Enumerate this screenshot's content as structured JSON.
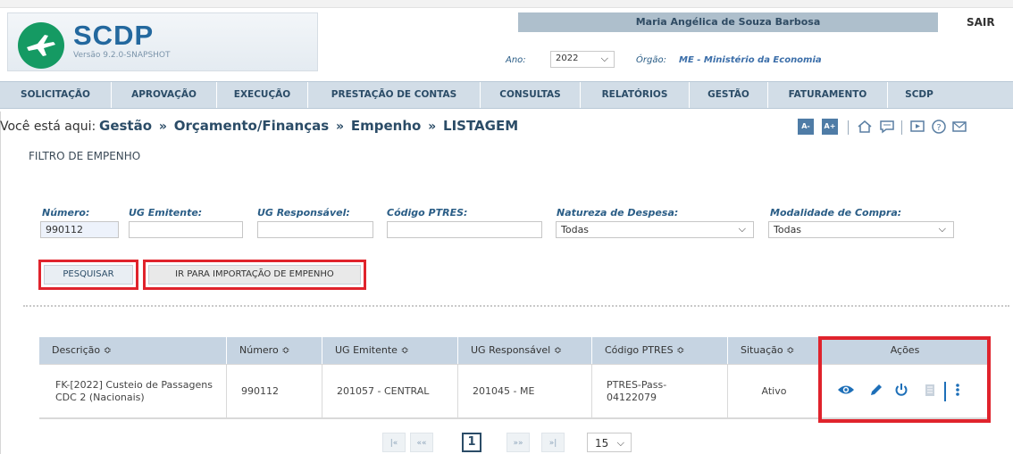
{
  "header": {
    "app_name": "SCDP",
    "version": "Versão 9.2.0-SNAPSHOT",
    "user_name": "Maria Angélica de Souza Barbosa",
    "logout_label": "SAIR",
    "ano_label": "Ano:",
    "ano_value": "2022",
    "orgao_label": "Órgão:",
    "orgao_value": "ME - Ministério da Economia"
  },
  "menu": {
    "items": [
      "SOLICITAÇÃO",
      "APROVAÇÃO",
      "EXECUÇÃO",
      "PRESTAÇÃO DE CONTAS",
      "CONSULTAS",
      "RELATÓRIOS",
      "GESTÃO",
      "FATURAMENTO",
      "SCDP"
    ]
  },
  "breadcrumb": {
    "prefix": "Você está aqui:",
    "parts": [
      "Gestão",
      "Orçamento/Finanças",
      "Empenho",
      "LISTAGEM"
    ],
    "separator": "»"
  },
  "toolbar": {
    "font_decrease": "A-",
    "font_increase": "A+",
    "icons": [
      "font-decrease-icon",
      "font-increase-icon",
      "home-icon",
      "chat-icon",
      "video-icon",
      "help-icon",
      "mail-icon"
    ]
  },
  "filter": {
    "title": "FILTRO DE EMPENHO",
    "fields": {
      "numero": {
        "label": "Número:",
        "value": "990112"
      },
      "ug_emitente": {
        "label": "UG Emitente:",
        "value": ""
      },
      "ug_responsavel": {
        "label": "UG Responsável:",
        "value": ""
      },
      "codigo_ptres": {
        "label": "Código PTRES:",
        "value": ""
      },
      "natureza_despesa": {
        "label": "Natureza de Despesa:",
        "value": "Todas"
      },
      "modalidade_compra": {
        "label": "Modalidade de Compra:",
        "value": "Todas"
      }
    },
    "search_button": "PESQUISAR",
    "import_button": "IR PARA IMPORTAÇÃO DE EMPENHO"
  },
  "table": {
    "columns": [
      "Descrição",
      "Número",
      "UG Emitente",
      "UG Responsável",
      "Código PTRES",
      "Situação",
      "Ações"
    ],
    "sort_glyph": "≎",
    "rows": [
      {
        "descricao": "FK-[2022] Custeio de Passagens CDC 2 (Nacionais)",
        "numero": "990112",
        "ug_emitente": "201057 - CENTRAL",
        "ug_responsavel": "201045 - ME",
        "codigo_ptres": "PTRES-Pass-04122079",
        "situacao": "Ativo"
      }
    ],
    "row_actions": [
      "view-icon",
      "edit-icon",
      "power-icon",
      "delete-icon",
      "more-icon"
    ]
  },
  "pagination": {
    "first": "|«",
    "prev": "««",
    "current": "1",
    "next": "»»",
    "last": "»|",
    "page_size": "15"
  },
  "colors": {
    "menu_bg": "#d2dde7",
    "header_blue": "#23689e",
    "table_header": "#c6d4e2",
    "highlight_red": "#e0232c",
    "logo_green": "#159a63"
  }
}
